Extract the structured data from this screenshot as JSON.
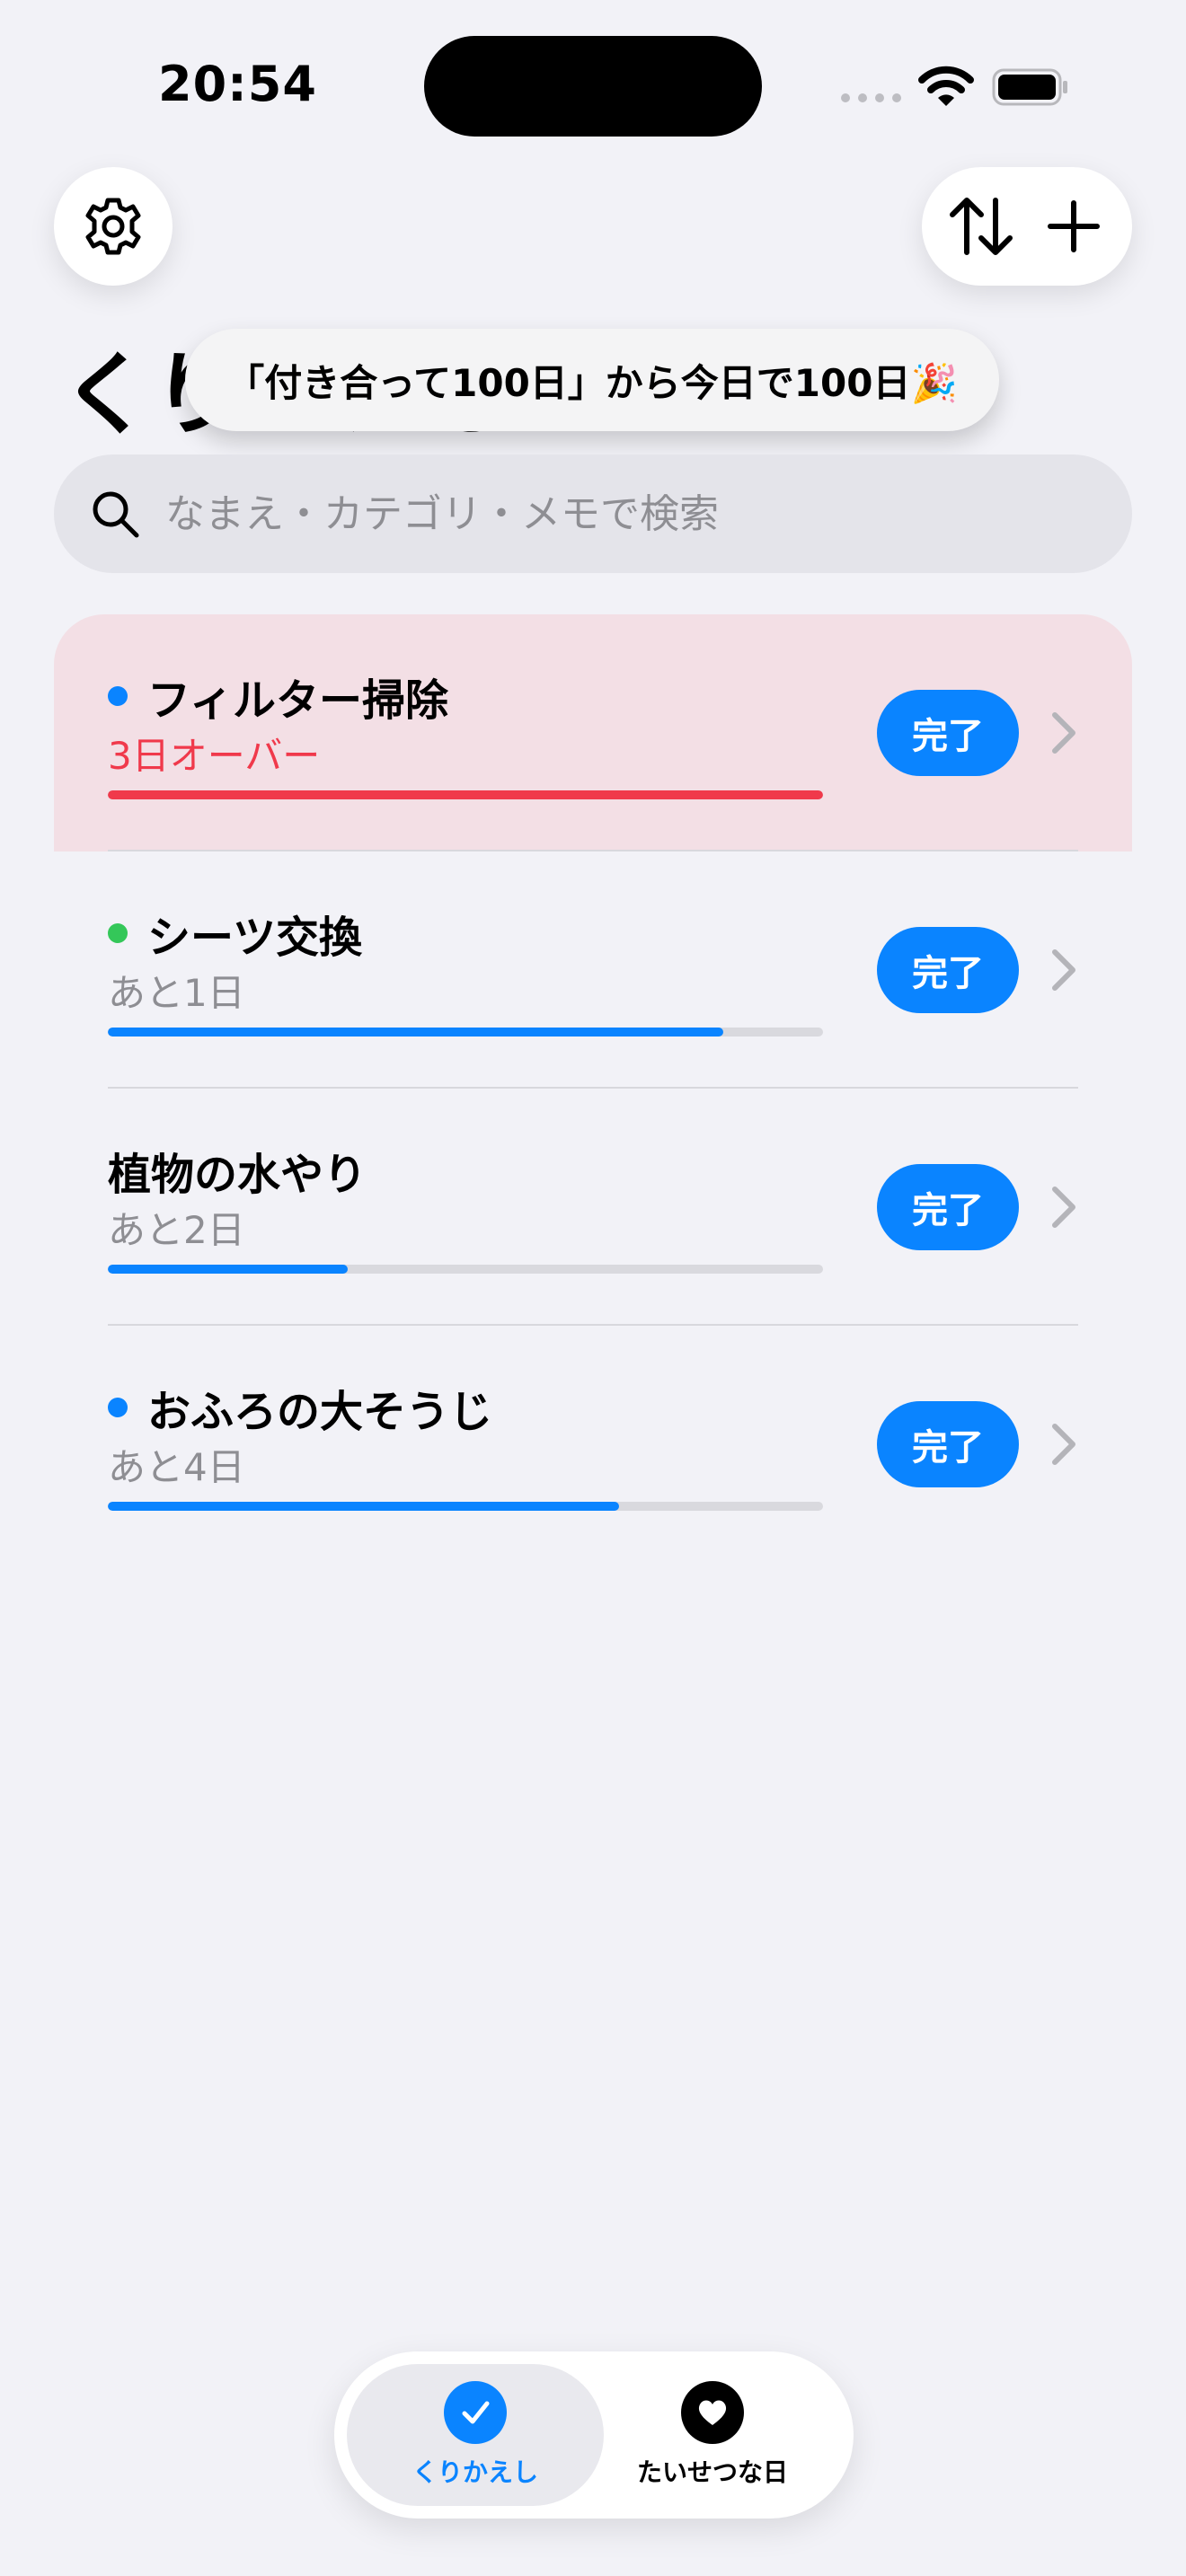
{
  "status_bar": {
    "time": "20:54"
  },
  "header": {
    "title": "くりかえし",
    "settings_icon": "gear-icon",
    "sort_icon": "sort-arrows-icon",
    "add_icon": "plus-icon"
  },
  "toast": {
    "text": "「付き合って100日」から今日で100日🎉"
  },
  "search": {
    "placeholder": "なまえ・カテゴリ・メモで検索",
    "value": ""
  },
  "items": [
    {
      "title": "フィルター掃除",
      "subtitle": "3日オーバー",
      "dot_color": "#0a84ff",
      "progress": 1.0,
      "progress_color": "#f0394b",
      "overdue": true,
      "button": "完了"
    },
    {
      "title": "シーツ交換",
      "subtitle": "あと1日",
      "dot_color": "#34c759",
      "progress": 0.86,
      "progress_color": "#0a84ff",
      "overdue": false,
      "button": "完了"
    },
    {
      "title": "植物の水やり",
      "subtitle": "あと2日",
      "dot_color": "",
      "progress": 0.335,
      "progress_color": "#0a84ff",
      "overdue": false,
      "button": "完了"
    },
    {
      "title": "おふろの大そうじ",
      "subtitle": "あと4日",
      "dot_color": "#0a84ff",
      "progress": 0.715,
      "progress_color": "#0a84ff",
      "overdue": false,
      "button": "完了"
    }
  ],
  "tabs": [
    {
      "label": "くりかえし",
      "icon": "checkmark-icon",
      "active": true,
      "color": "#0a84ff"
    },
    {
      "label": "たいせつな日",
      "icon": "heart-icon",
      "active": false,
      "color": "#000000"
    }
  ],
  "colors": {
    "accent": "#0a84ff",
    "alert": "#f0394b",
    "overdue_bg": "#f3dfe5",
    "background": "#f2f2f7"
  }
}
